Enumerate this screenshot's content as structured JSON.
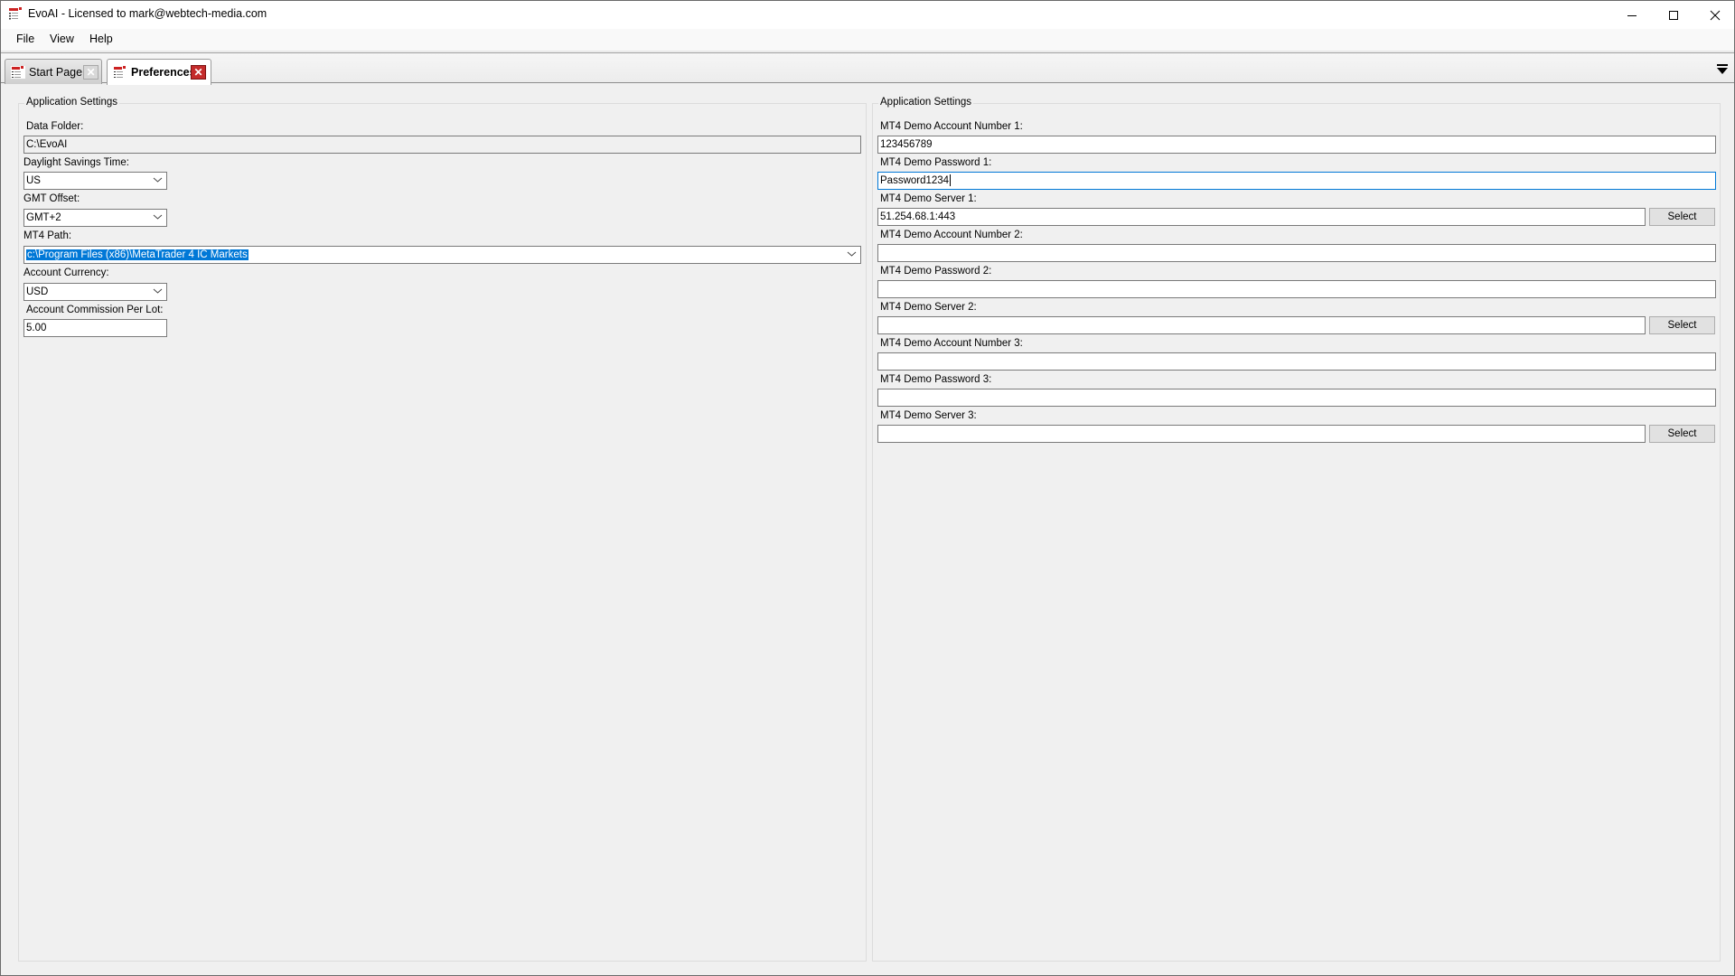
{
  "window": {
    "title": "EvoAI - Licensed to mark@webtech-media.com",
    "controls": {
      "minimize": "minimize",
      "maximize": "maximize",
      "close": "close"
    }
  },
  "menu": {
    "items": [
      {
        "label": "File"
      },
      {
        "label": "View"
      },
      {
        "label": "Help"
      }
    ]
  },
  "tabs": [
    {
      "label": "Start Page",
      "active": false,
      "close_glyph": "✕"
    },
    {
      "label": "Preferences",
      "active": true,
      "close_glyph": "✕"
    }
  ],
  "left_panel": {
    "group_title": "Application Settings",
    "data_folder": {
      "label": "Data Folder:",
      "value": "C:\\EvoAI"
    },
    "daylight_savings": {
      "label": "Daylight Savings Time:",
      "value": "US"
    },
    "gmt_offset": {
      "label": "GMT Offset:",
      "value": "GMT+2"
    },
    "mt4_path": {
      "label": "MT4 Path:",
      "value": "c:\\Program Files (x86)\\MetaTrader 4 IC Markets"
    },
    "account_currency": {
      "label": "Account Currency:",
      "value": "USD"
    },
    "commission": {
      "label": "Account Commission Per Lot:",
      "value": "5.00"
    }
  },
  "right_panel": {
    "group_title": "Application Settings",
    "select_label": "Select",
    "fields": [
      {
        "label": "MT4 Demo Account Number 1:",
        "value": "123456789"
      },
      {
        "label": "MT4 Demo Password 1:",
        "value": "Password1234"
      },
      {
        "label": "MT4 Demo Server 1:",
        "value": "51.254.68.1:443"
      },
      {
        "label": "MT4 Demo Account Number 2:",
        "value": ""
      },
      {
        "label": "MT4 Demo Password 2:",
        "value": ""
      },
      {
        "label": "MT4 Demo Server 2:",
        "value": ""
      },
      {
        "label": "MT4 Demo Account Number 3:",
        "value": ""
      },
      {
        "label": "MT4 Demo Password 3:",
        "value": ""
      },
      {
        "label": "MT4 Demo Server 3:",
        "value": ""
      }
    ]
  },
  "colors": {
    "selection": "#0078d7",
    "focus_border": "#0078d7",
    "tab_close_active": "#c42b2b",
    "background": "#f0f0f0"
  }
}
